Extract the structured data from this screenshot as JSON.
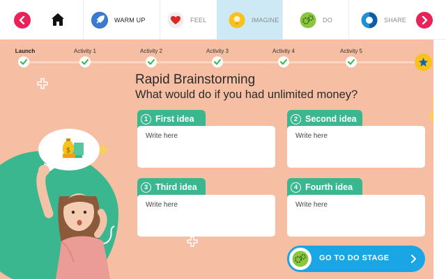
{
  "nav": {
    "stages": [
      {
        "label": "WARM UP",
        "icon": "rocket-icon",
        "active": false
      },
      {
        "label": "FEEL",
        "icon": "heart-icon",
        "active": false
      },
      {
        "label": "IMAGINE",
        "icon": "lightbulb-icon",
        "active": true
      },
      {
        "label": "DO",
        "icon": "gears-icon",
        "active": false
      },
      {
        "label": "SHARE",
        "icon": "share-icon",
        "active": false
      }
    ]
  },
  "progress": {
    "steps": [
      {
        "label": "Launch",
        "completed": true
      },
      {
        "label": "Activity 1",
        "completed": true
      },
      {
        "label": "Activity 2",
        "completed": true
      },
      {
        "label": "Activity 3",
        "completed": true
      },
      {
        "label": "Activity 4",
        "completed": true
      },
      {
        "label": "Activity 5",
        "completed": true
      }
    ],
    "final_icon": "star-icon"
  },
  "content": {
    "title": "Rapid Brainstorming",
    "question": "What would do if you had unlimited money?",
    "ideas": [
      {
        "number": "1",
        "label": "First idea",
        "placeholder": "Write here"
      },
      {
        "number": "2",
        "label": "Second idea",
        "placeholder": "Write here"
      },
      {
        "number": "3",
        "label": "Third idea",
        "placeholder": "Write here"
      },
      {
        "number": "4",
        "label": "Fourth idea",
        "placeholder": "Write here"
      }
    ]
  },
  "cta": {
    "label": "GO TO DO STAGE",
    "icon": "gears-icon"
  },
  "colors": {
    "accent_red": "#e8235a",
    "panel_bg": "#f6bfa3",
    "green": "#3bb78f",
    "blue": "#1aa6e4",
    "active_tab": "#cde9f6"
  }
}
